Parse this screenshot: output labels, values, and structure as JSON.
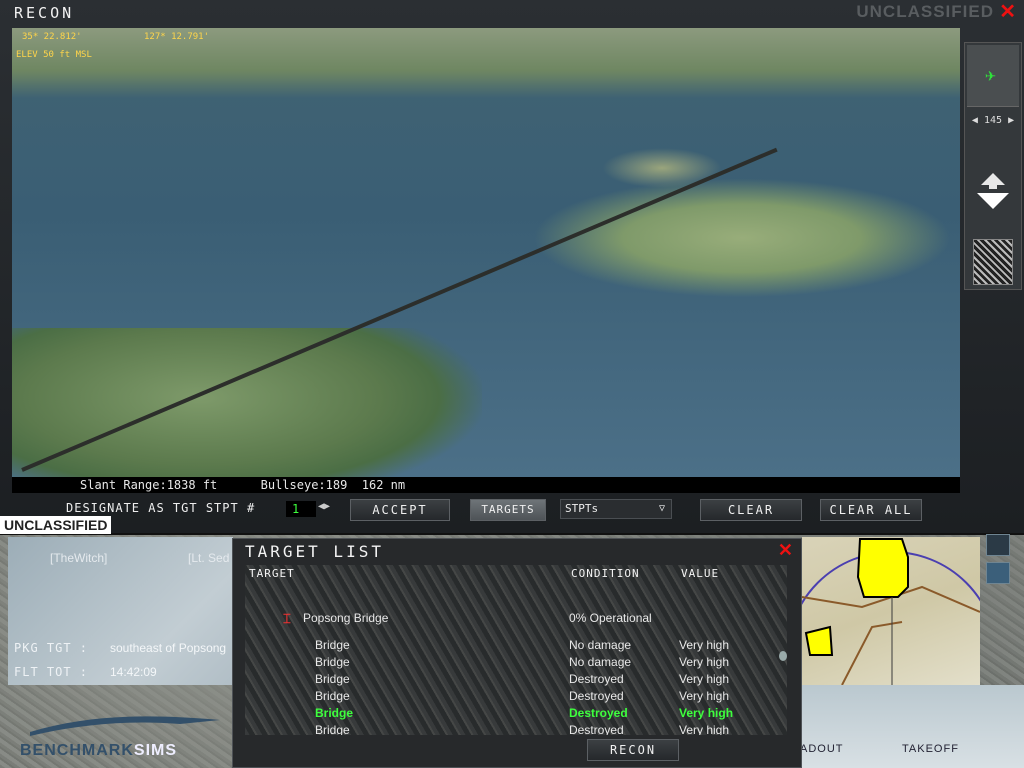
{
  "recon": {
    "title": "RECON",
    "unclassified_top": "UNCLASSIFIED",
    "hud": {
      "lat": "35* 22.812'",
      "lon": "127* 12.791'",
      "elev": "ELEV 50 ft MSL"
    },
    "slant_bar": "Slant Range:1838 ft      Bullseye:189  162 nm",
    "nav": {
      "heading": "145"
    },
    "controls": {
      "designate_label": "DESIGNATE AS TGT STPT #",
      "stpt_number": "1",
      "accept": "ACCEPT",
      "targets": "TARGETS",
      "stpts_dropdown": "STPTs",
      "clear": "CLEAR",
      "clear_all": "CLEAR ALL"
    }
  },
  "unclassified_banner": "UNCLASSIFIED",
  "brief": {
    "callsign1": "[TheWitch]",
    "callsign2": "[Lt. Sed",
    "pkg_tgt_label": "PKG TGT",
    "pkg_tgt_value": "southeast of Popsong",
    "flt_tot_label": "FLT TOT",
    "flt_tot_value": "14:42:09",
    "logo": "BENCHMARK",
    "logo2": "SIMS"
  },
  "bottom_right": {
    "loadout": "ADOUT",
    "takeoff": "TAKEOFF"
  },
  "target_list": {
    "title": "TARGET LIST",
    "columns": {
      "target": "TARGET",
      "condition": "CONDITION",
      "value": "VALUE"
    },
    "parent": {
      "name": "Popsong Bridge",
      "condition": "0% Operational"
    },
    "rows": [
      {
        "target": "Bridge",
        "condition": "No damage",
        "value": "Very high"
      },
      {
        "target": "Bridge",
        "condition": "No damage",
        "value": "Very high"
      },
      {
        "target": "Bridge",
        "condition": "Destroyed",
        "value": "Very high"
      },
      {
        "target": "Bridge",
        "condition": "Destroyed",
        "value": "Very high"
      },
      {
        "target": "Bridge",
        "condition": "Destroyed",
        "value": "Very high"
      },
      {
        "target": "Bridge",
        "condition": "Destroyed",
        "value": "Very high"
      }
    ],
    "recon_button": "RECON"
  },
  "colors": {
    "highlight": "#3dff3d",
    "close": "#e11111",
    "hud": "#ffd54a"
  }
}
